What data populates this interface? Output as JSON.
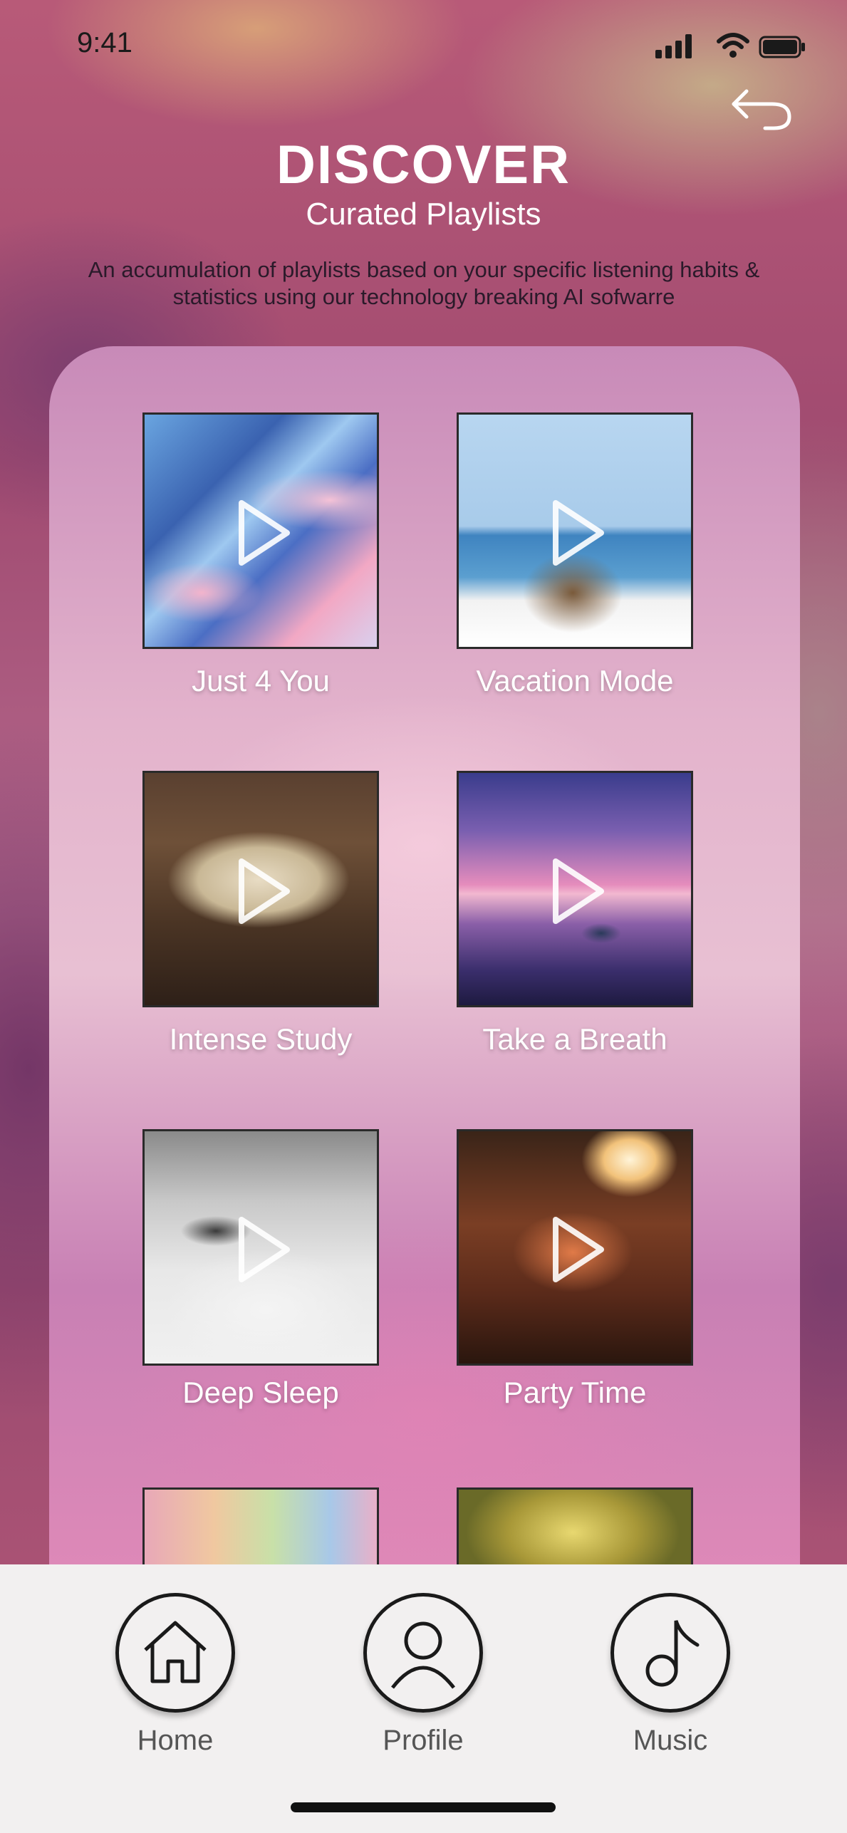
{
  "status_bar": {
    "time": "9:41"
  },
  "header": {
    "title": "DISCOVER",
    "subtitle": "Curated Playlists",
    "description": "An accumulation of playlists based on your specific listening habits & statistics using our technology breaking AI sofwarre"
  },
  "playlists": [
    {
      "label": "Just 4 You",
      "icon": "play-icon"
    },
    {
      "label": "Vacation Mode",
      "icon": "play-icon"
    },
    {
      "label": "Intense Study",
      "icon": "play-icon"
    },
    {
      "label": "Take a Breath",
      "icon": "play-icon"
    },
    {
      "label": "Deep Sleep",
      "icon": "play-icon"
    },
    {
      "label": "Party Time",
      "icon": "play-icon"
    }
  ],
  "nav": {
    "items": [
      {
        "label": "Home",
        "icon": "home-icon"
      },
      {
        "label": "Profile",
        "icon": "profile-icon"
      },
      {
        "label": "Music",
        "icon": "music-note-icon"
      }
    ]
  },
  "colors": {
    "accent": "#ffffff",
    "nav_background": "#f2f0f0",
    "nav_text": "#555555"
  }
}
